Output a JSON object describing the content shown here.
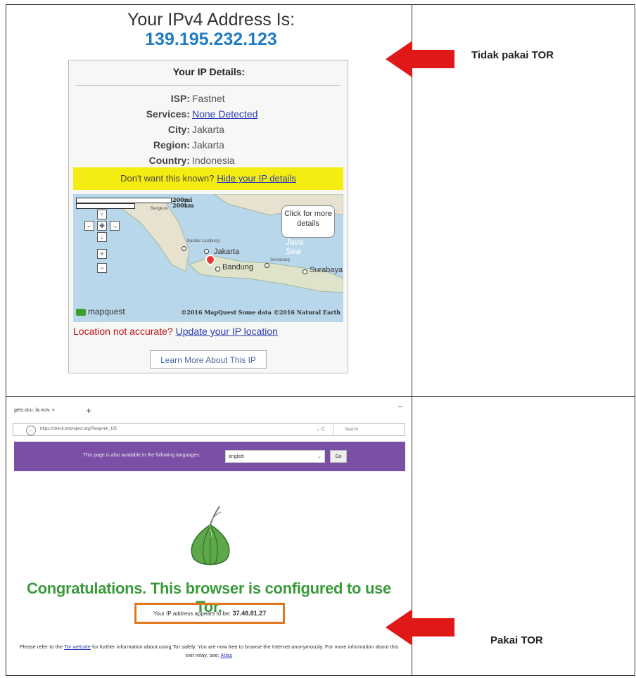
{
  "top": {
    "title": "Your IPv4 Address Is:",
    "ip": "139.195.232.123",
    "details": {
      "title": "Your IP Details:",
      "isp_label": "ISP:",
      "isp": "Fastnet",
      "services_label": "Services:",
      "services": "None Detected",
      "city_label": "City:",
      "city": "Jakarta",
      "region_label": "Region:",
      "region": "Jakarta",
      "country_label": "Country:",
      "country": "Indonesia",
      "hide_prompt": "Don't want this known?",
      "hide_link": "Hide your IP details"
    },
    "map": {
      "scale_mi": "200mi",
      "scale_km": "200km",
      "callout": "Click for more details",
      "places": {
        "jakarta": "Jakarta",
        "bandung": "Bandung",
        "surabaya": "Surabaya",
        "bandar_lampung": "Bandar Lampung",
        "semarang": "Semarang",
        "bengkulu": "Bengkulu",
        "java_sea": "Java Sea"
      },
      "logo": "mapquest",
      "copyright": "©2016 MapQuest Some data ©2016 Natural Earth"
    },
    "location_prompt": "Location not accurate?",
    "location_link": "Update your IP location",
    "learn_more": "Learn More About This IP",
    "annotation": "Tidak pakai TOR"
  },
  "bottom": {
    "tab_title": "gets.dcu. la.ncw. ×",
    "url": "https://check.torproject.org/?lang=en_US",
    "search_placeholder": "Search",
    "lang_prompt": "This page is also available in the following languages:",
    "lang_selected": "english",
    "go": "Go",
    "congrats": "Congratulations. This browser is configured to use Tor.",
    "ip_prompt": "Your IP address appears to be:",
    "ip": "37.48.81.27",
    "refer_1": "Please refer to the",
    "refer_link": "Tor website",
    "refer_2": "for further information about using Tor safely. You are now free to browse the Internet anonymously. For more information about this exit relay, see:",
    "atlas": "Atlas",
    "annotation": "Pakai TOR"
  },
  "colors": {
    "ip_blue": "#1e7bc4",
    "arrow_red": "#e01818",
    "tor_green": "#3a9a3a",
    "tor_purple": "#7a4fa5",
    "highlight_orange": "#e07820",
    "hide_bar_yellow": "#f5ec12"
  }
}
